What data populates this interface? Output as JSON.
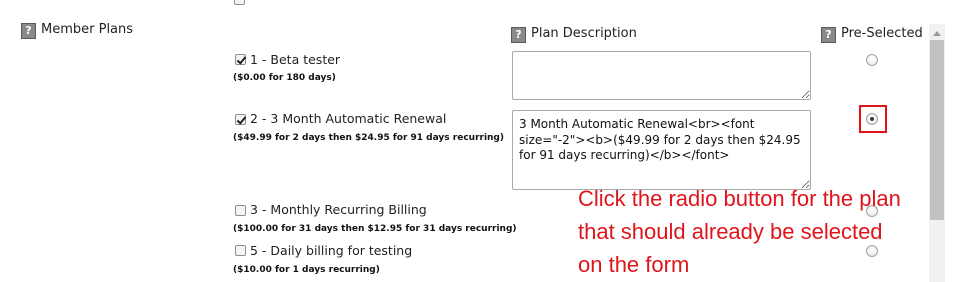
{
  "member_plans": {
    "label": "Member Plans",
    "help_icon": "question-mark-icon"
  },
  "columns": {
    "plan_description": "Plan Description",
    "pre_selected": "Pre-Selected"
  },
  "plans": [
    {
      "title": "1 - Beta tester",
      "subtitle": "($0.00 for 180 days)",
      "checked": true,
      "description": "",
      "pre_selected": false
    },
    {
      "title": "2 - 3 Month Automatic Renewal",
      "subtitle": "($49.99 for 2 days then $24.95 for 91 days recurring)",
      "checked": true,
      "description": "3 Month Automatic Renewal<br><font size=\"-2\"><b>($49.99 for 2 days then $24.95 for 91 days recurring)</b></font>",
      "pre_selected": true
    },
    {
      "title": "3 - Monthly Recurring Billing",
      "subtitle": "($100.00 for 31 days then $12.95 for 31 days recurring)",
      "checked": false,
      "pre_selected": false
    },
    {
      "title": "5 - Daily billing for testing",
      "subtitle": "($10.00 for 1 days recurring)",
      "checked": false,
      "pre_selected": false
    }
  ],
  "annotation": {
    "text": "Click the radio button for the plan that should already be selected on the form",
    "color": "#e0141b"
  }
}
